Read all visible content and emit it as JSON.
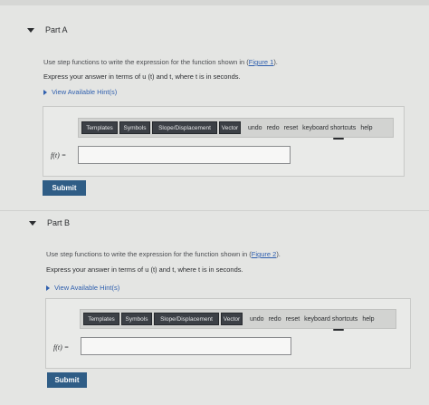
{
  "partA": {
    "title": "Part A",
    "prompt_before": "Use step functions to write the expression for the function shown in (",
    "figure_link": "Figure 1",
    "prompt_after": ").",
    "instruction": "Express your answer in terms of u (t) and t, where t is in seconds.",
    "hints": "View Available Hint(s)",
    "eq_label": "f(t) =",
    "submit": "Submit"
  },
  "partB": {
    "title": "Part B",
    "prompt_before": "Use step functions to write the expression for the function shown in (",
    "figure_link": "Figure 2",
    "prompt_after": ").",
    "instruction": "Express your answer in terms of u (t) and t, where t is in seconds.",
    "hints": "View Available Hint(s)",
    "eq_label": "f(t) =",
    "submit": "Submit"
  },
  "toolbar": {
    "templates": "Templates",
    "symbols": "Symbols",
    "slope": "Slope/Displacement",
    "vector": "Vector",
    "undo": "undo",
    "redo": "redo",
    "reset": "reset",
    "keyboard": "keyboard shortcuts",
    "help": "help"
  },
  "colors": {
    "link": "#2f5fae",
    "submit_bg": "#2f5d86",
    "toolbar_button": "#3c4046",
    "page_bg": "#e4e5e3"
  }
}
